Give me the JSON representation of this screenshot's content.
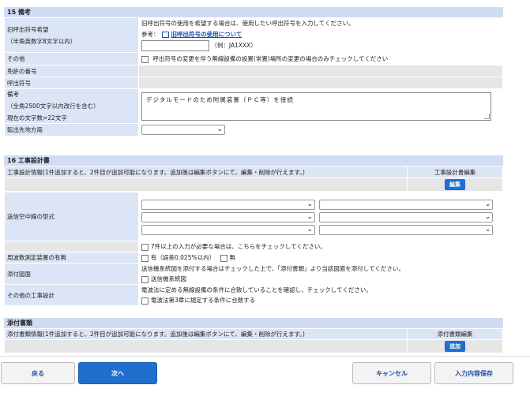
{
  "sec15": {
    "title": "15 備考",
    "callsign_label": "旧呼出符号希望",
    "callsign_sublabel": "（半角英数字8文字以内）",
    "callsign_note": "旧呼出符号の使用を希望する場合は、使用したい呼出符号を入力してください。",
    "ref_prefix": "参考：",
    "ref_link": "旧呼出符号の使用について",
    "callsign_example": "（例：JA1XXX）",
    "other_label": "その他",
    "other_check_text": "呼出符号の変更を伴う無線設備の設置(常置)場所の変更の場合のみチェックしてください",
    "license_no_label": "免許の番号",
    "call_sign_label": "呼出符号",
    "remarks_label": "備考",
    "remarks_sub1": "（全角2500文字以内改行を含む）",
    "remarks_sub2": "現在の文字数>22文字",
    "remarks_value": "デジタルモードのため附属装置（ＰＣ等）を接続",
    "transfer_label": "転出先地方局"
  },
  "sec16": {
    "title": "16 工事設計書",
    "design_info": "工事設計情報(1件追加すると、2件目が追加可能になります。追加後は編集ボタンにて、編集・削除が行えます。)",
    "design_edit_header": "工事設計書編集",
    "edit_button": "編集",
    "antenna_label": "送信空中線の型式",
    "antenna_check_text": "7件以上の入力が必要な場合は、こちらをチェックしてください。",
    "freq_label": "周波数測定装置の有無",
    "freq_yes": "有（誤差0.025%以内）",
    "freq_no": "無",
    "attach_label": "添付図面",
    "attach_note": "送信機系統図を添付する場合はチェックした上で、「添付書類」より当該図面を添付してください。",
    "attach_check": "送信機系統図",
    "other_design_label": "その他の工事設計",
    "other_design_note": "電波法に定める無線設備の条件に合致していることを確認し、チェックしてください。",
    "other_design_check": "電波法第3章に規定する条件に合致する"
  },
  "attach": {
    "title": "添付書類",
    "info": "添付書類情報(1件追加すると、2件目が追加可能になります。追加後は編集ボタンにて、編集・削除が行えます。)",
    "edit_header": "添付書類編集",
    "add_button": "追加"
  },
  "footer": {
    "back": "戻る",
    "next": "次へ",
    "cancel": "キャンセル",
    "save": "入力内容保存"
  }
}
